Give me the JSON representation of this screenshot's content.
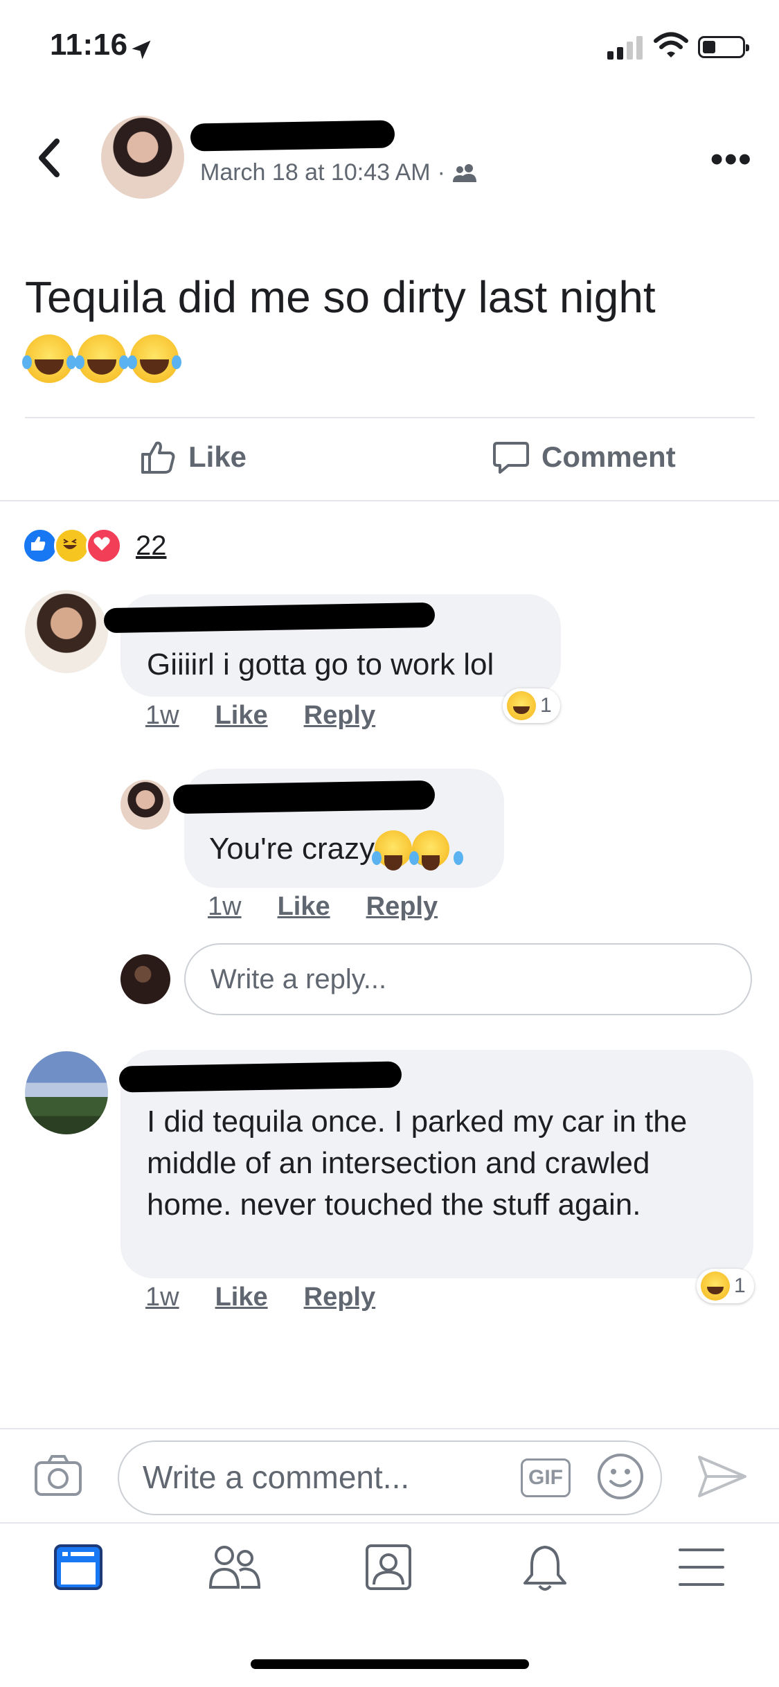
{
  "status_bar": {
    "time": "11:16"
  },
  "post": {
    "date": "March 18 at 10:43 AM",
    "separator": "·",
    "text": "Tequila did me so dirty last night",
    "actions": {
      "like": "Like",
      "comment": "Comment"
    },
    "reaction_count": "22"
  },
  "comments": [
    {
      "text": "Giiiirl i gotta go to work lol",
      "time": "1w",
      "like": "Like",
      "reply": "Reply",
      "reaction_count": "1",
      "replies": [
        {
          "text": "You're crazy",
          "time": "1w",
          "like": "Like",
          "reply": "Reply"
        }
      ],
      "reply_placeholder": "Write a reply..."
    },
    {
      "text": "I did tequila once. I parked my car in the middle of an intersection and crawled home. never touched the stuff again.",
      "time": "1w",
      "like": "Like",
      "reply": "Reply",
      "reaction_count": "1"
    }
  ],
  "composer": {
    "placeholder": "Write a comment...",
    "gif": "GIF"
  },
  "colors": {
    "accent": "#1877f2",
    "text": "#1c1e21",
    "muted": "#606770",
    "bubble": "#f0f2f5",
    "haha": "#f7c51f",
    "love": "#f33e58"
  },
  "icons": [
    "location-arrow-icon",
    "signal-icon",
    "wifi-icon",
    "battery-icon",
    "back-chevron-icon",
    "more-icon",
    "friends-audience-icon",
    "thumbs-up-icon",
    "comment-icon",
    "camera-icon",
    "smile-icon",
    "send-icon",
    "news-feed-icon",
    "friends-icon",
    "profile-icon",
    "bell-icon",
    "menu-icon"
  ]
}
